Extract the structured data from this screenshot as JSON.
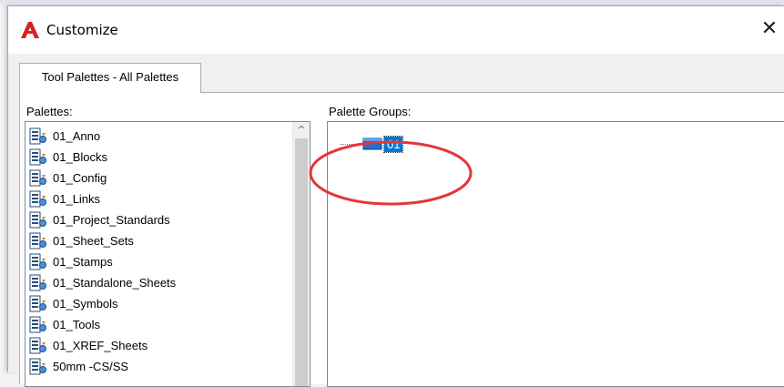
{
  "window": {
    "title": "Customize",
    "close_glyph": "✕"
  },
  "icons": {
    "app": "autocad-logo-icon",
    "palette": "tool-palette-icon",
    "group": "palette-group-icon",
    "scroll_up": "scroll-up-arrow-icon"
  },
  "colors": {
    "app_logo": "#d9221c",
    "selection": "#0078d7",
    "annotation": "#e5353b"
  },
  "tabs": [
    {
      "label": "Tool Palettes - All Palettes",
      "selected": true
    }
  ],
  "palettes": {
    "label": "Palettes:",
    "items": [
      "01_Anno",
      "01_Blocks",
      "01_Config",
      "01_Links",
      "01_Project_Standards",
      "01_Sheet_Sets",
      "01_Stamps",
      "01_Standalone_Sheets",
      "01_Symbols",
      "01_Tools",
      "01_XREF_Sheets",
      "50mm -CS/SS"
    ],
    "scroll_up_glyph": "^"
  },
  "palette_groups": {
    "label": "Palette Groups:",
    "selected_node": "01"
  }
}
